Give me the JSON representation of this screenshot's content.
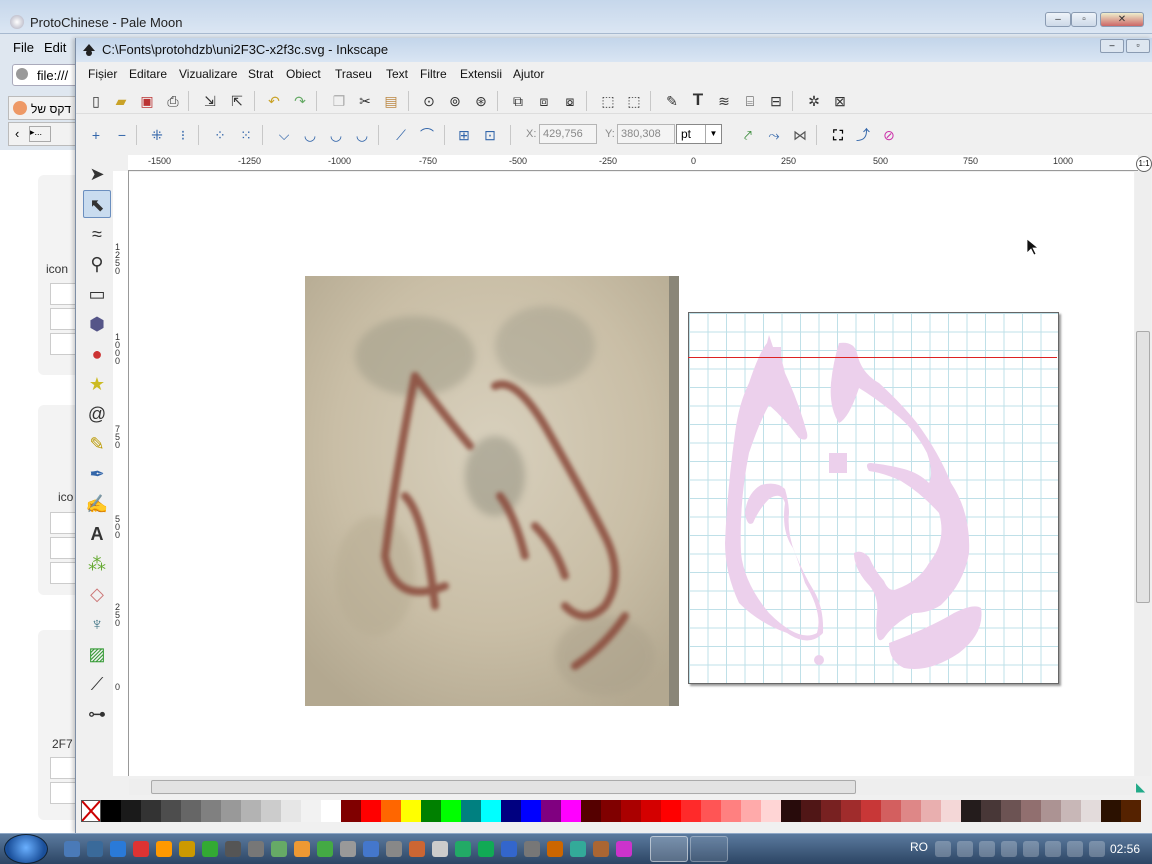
{
  "browser": {
    "title": "ProtoChinese - Pale Moon",
    "menu": {
      "file": "File",
      "edit": "Edit"
    },
    "url_prefix": "file:///",
    "tab_hebrew": "דקס של",
    "labels": [
      "icon",
      "ico",
      "2F7"
    ]
  },
  "inkscape": {
    "title": "C:\\Fonts\\protohdzb\\uni2F3C-x2f3c.svg - Inkscape",
    "menu": [
      "Fișier",
      "Editare",
      "Vizualizare",
      "Strat",
      "Obiect",
      "Traseu",
      "Text",
      "Filtre",
      "Extensii",
      "Ajutor"
    ],
    "toolbar2": {
      "x_label": "X:",
      "x_value": "429,756",
      "y_label": "Y:",
      "y_value": "380,308",
      "unit": "pt"
    },
    "hruler_labels": [
      "-1500",
      "-1250",
      "-1000",
      "-750",
      "-500",
      "-250",
      "0",
      "250",
      "500",
      "750",
      "1000"
    ],
    "vruler_labels": [
      "1250",
      "1000",
      "750",
      "500",
      "250",
      "0"
    ],
    "zoom_corner": "1:1",
    "tools": [
      "selector-icon",
      "node-icon",
      "tweak-icon",
      "zoom-icon",
      "rect-icon",
      "3dbox-icon",
      "ellipse-icon",
      "star-icon",
      "spiral-icon",
      "pencil-icon",
      "pen-icon",
      "calligraphy-icon",
      "text-icon",
      "spray-icon",
      "eraser-icon",
      "bucket-icon",
      "gradient-icon",
      "dropper-icon",
      "connector-icon"
    ],
    "palette_colors": [
      "#000000",
      "#1a1a1a",
      "#333333",
      "#4d4d4d",
      "#666666",
      "#808080",
      "#999999",
      "#b3b3b3",
      "#cccccc",
      "#e6e6e6",
      "#f2f2f2",
      "#ffffff",
      "#800000",
      "#ff0000",
      "#ff6600",
      "#ffff00",
      "#008000",
      "#00ff00",
      "#008080",
      "#00ffff",
      "#000080",
      "#0000ff",
      "#800080",
      "#ff00ff",
      "#550000",
      "#800000",
      "#aa0000",
      "#d40000",
      "#ff0000",
      "#ff2a2a",
      "#ff5555",
      "#ff8080",
      "#ffaaaa",
      "#ffd5d5",
      "#280b0b",
      "#501616",
      "#782121",
      "#a02c2c",
      "#c83737",
      "#d35f5f",
      "#de8787",
      "#e9afaf",
      "#f4d7d7",
      "#241c1c",
      "#483737",
      "#6c5353",
      "#916f6f",
      "#ac9393",
      "#c8b7b7",
      "#e3dbdb",
      "#2b1100",
      "#552200"
    ]
  },
  "taskbar": {
    "lang": "RO",
    "clock": "02:56"
  }
}
